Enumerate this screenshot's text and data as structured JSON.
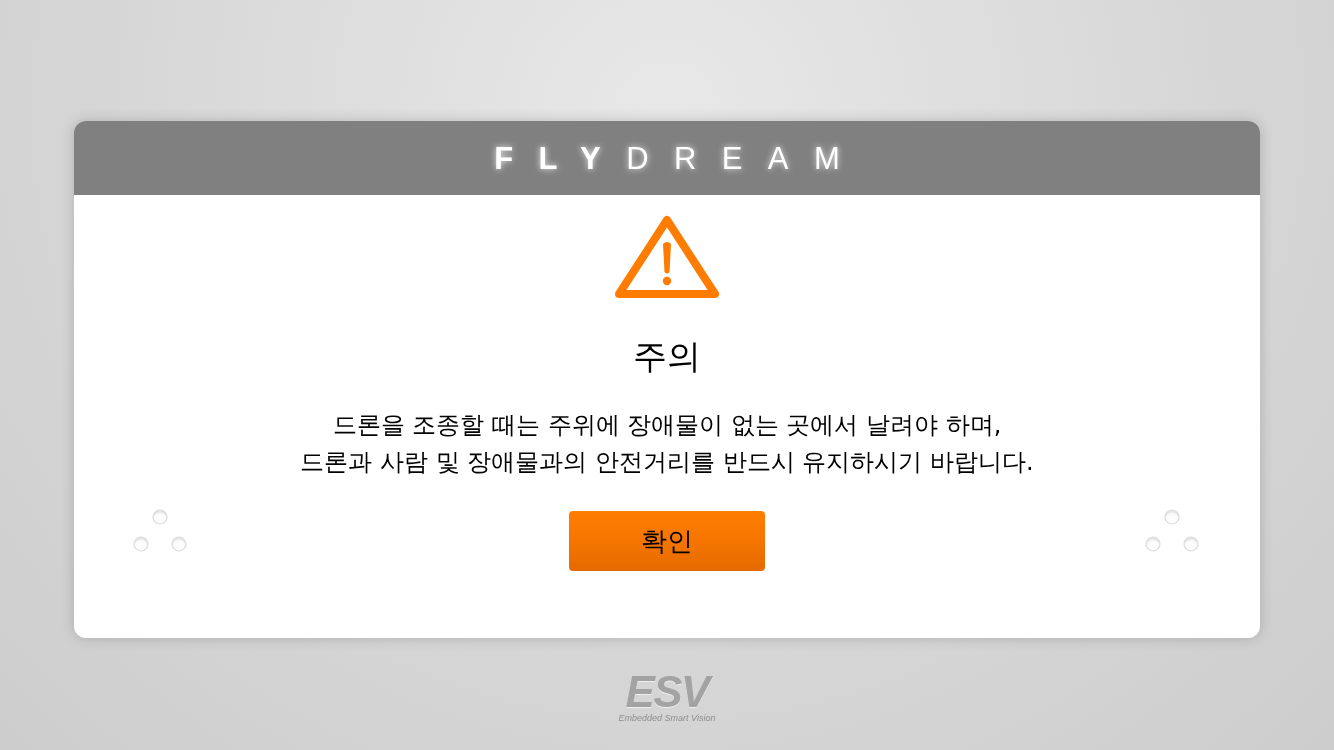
{
  "header": {
    "logo": "**FLY**DREAM"
  },
  "dialog": {
    "title": "주의",
    "message": "드론을 조종할 때는 주위에 장애물이 없는 곳에서 날려야 하며,\n드론과 사람 및 장애물과의 안전거리를 반드시 유지하시기 바랍니다.",
    "buttons": [
      "확인"
    ]
  },
  "footer": {
    "logo": "ESV",
    "tagline": "Embedded Smart Vision"
  }
}
